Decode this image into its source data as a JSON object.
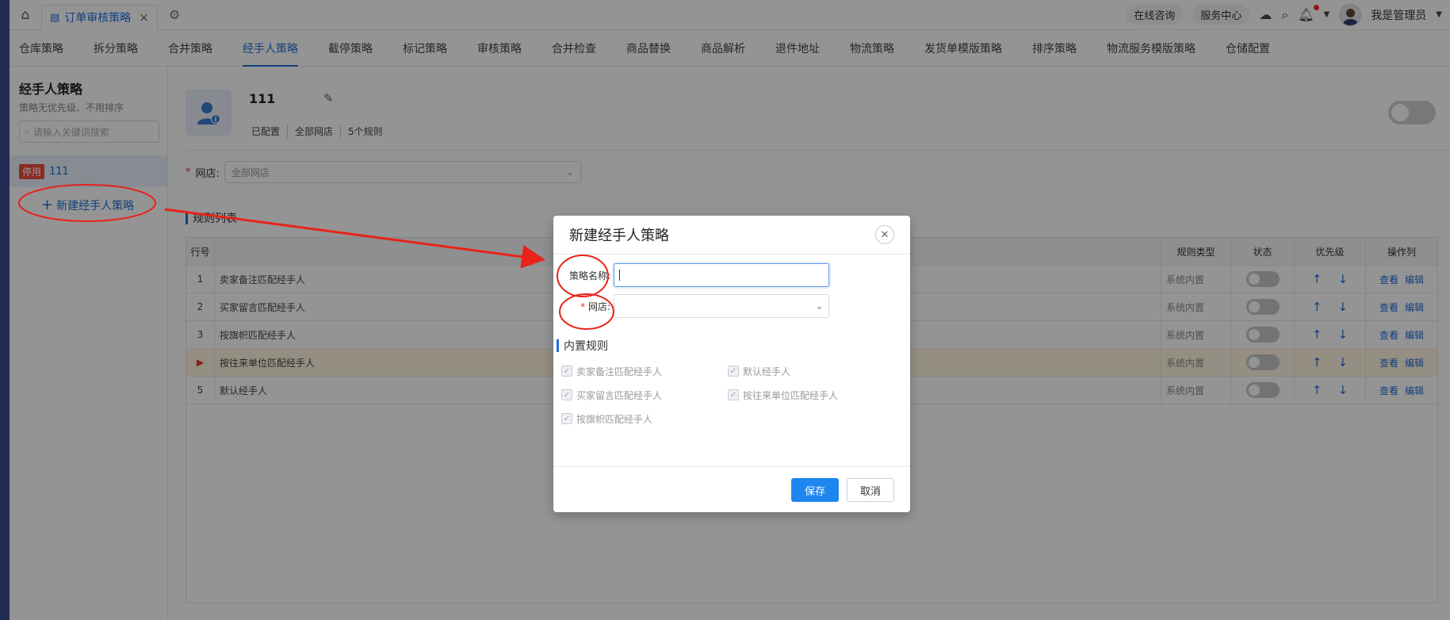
{
  "topbar": {
    "tab_label": "订单审核策略",
    "tab_close": "×",
    "online_consult": "在线咨询",
    "service_center": "服务中心",
    "user_name": "我是管理员"
  },
  "nav": {
    "tabs": [
      "仓库策略",
      "拆分策略",
      "合并策略",
      "经手人策略",
      "截停策略",
      "标记策略",
      "审核策略",
      "合并检查",
      "商品替换",
      "商品解析",
      "退件地址",
      "物流策略",
      "发货单模版策略",
      "排序策略",
      "物流服务模版策略",
      "仓储配置"
    ],
    "active_index": 3
  },
  "sidebar": {
    "title": "经手人策略",
    "subtitle": "策略无优先级、不用排序",
    "search_placeholder": "请输入关键词搜索",
    "items": [
      {
        "badge": "停用",
        "label": "111"
      }
    ],
    "new_label": "新建经手人策略"
  },
  "main": {
    "strategy_name": "111",
    "meta": [
      "已配置",
      "全部网店",
      "5个规则"
    ],
    "shop_label": "网店:",
    "shop_value": "全部网店",
    "rules_title": "规则列表",
    "columns": {
      "no": "行号",
      "type": "规则类型",
      "state": "状态",
      "priority": "优先级",
      "ops": "操作列"
    },
    "rows": [
      {
        "no": "1",
        "name": "卖家备注匹配经手人",
        "type": "系统内置",
        "view": "查看",
        "edit": "编辑"
      },
      {
        "no": "2",
        "name": "买家留言匹配经手人",
        "type": "系统内置",
        "view": "查看",
        "edit": "编辑"
      },
      {
        "no": "3",
        "name": "按旗帜匹配经手人",
        "type": "系统内置",
        "view": "查看",
        "edit": "编辑"
      },
      {
        "no": "▶",
        "name": "按往来单位匹配经手人",
        "type": "系统内置",
        "view": "查看",
        "edit": "编辑"
      },
      {
        "no": "5",
        "name": "默认经手人",
        "type": "系统内置",
        "view": "查看",
        "edit": "编辑"
      }
    ],
    "highlighted_row": 3
  },
  "modal": {
    "title": "新建经手人策略",
    "name_label": "策略名称:",
    "name_value": "",
    "shop_label": "网店:",
    "shop_value": "",
    "builtin_title": "内置规则",
    "builtin_rules": [
      "卖家备注匹配经手人",
      "默认经手人",
      "买家留言匹配经手人",
      "按往来单位匹配经手人",
      "按旗帜匹配经手人"
    ],
    "save_label": "保存",
    "cancel_label": "取消"
  },
  "colors": {
    "accent": "#1f6fd8",
    "danger": "#f04a3c",
    "annotation": "#e8231b",
    "overlay": "rgba(0,0,0,0.42)"
  }
}
